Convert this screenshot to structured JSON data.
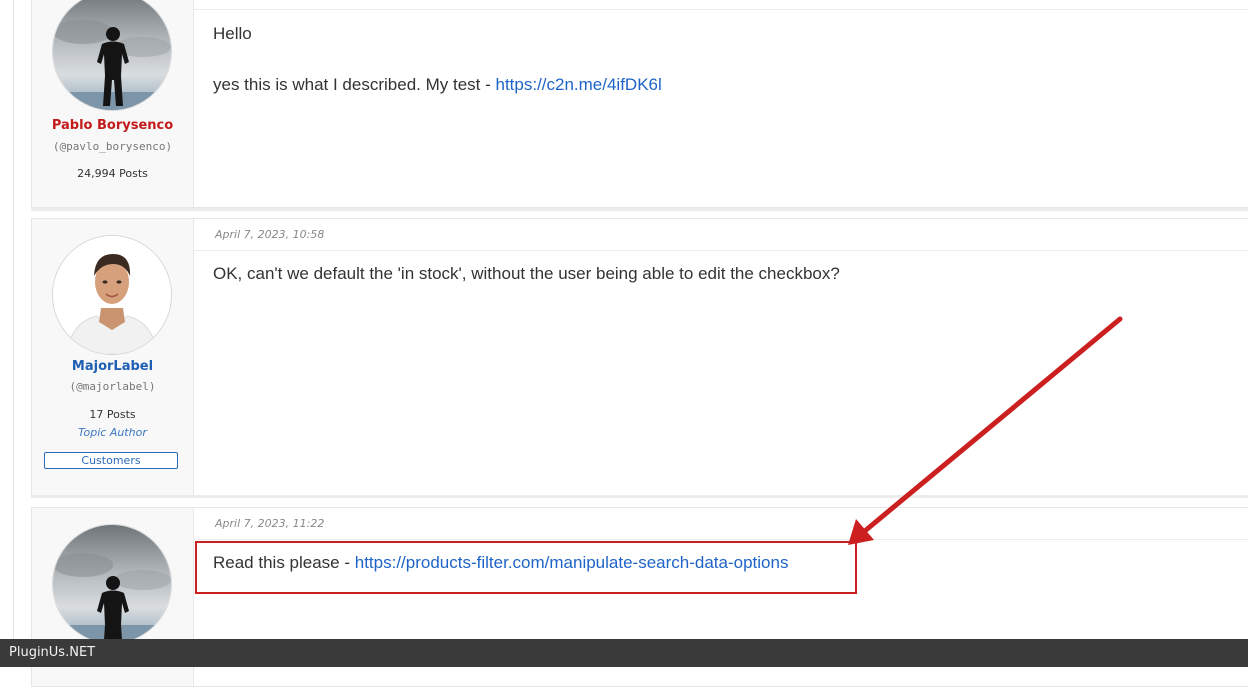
{
  "posts": [
    {
      "author": {
        "name": "Pablo Borysenco",
        "handle": "(@pavlo_borysenco)",
        "posts": "24,994 Posts",
        "name_color": "#c31b1b"
      },
      "lines": [
        "Hello",
        "yes this is what I described. My test - "
      ],
      "link": "https://c2n.me/4ifDK6l"
    },
    {
      "date": "April 7, 2023, 10:58",
      "author": {
        "name": "MajorLabel",
        "handle": "(@majorlabel)",
        "posts": "17 Posts",
        "badge": "Topic Author",
        "role": "Customers",
        "name_color": "#1e5fb4"
      },
      "text": "OK, can't we default the 'in stock', without the user being able to edit the checkbox?"
    },
    {
      "date": "April 7, 2023, 11:22",
      "text_prefix": "Read this please - ",
      "link": "https://products-filter.com/manipulate-search-data-options"
    }
  ],
  "footer": {
    "brand": "PluginUs.NET"
  },
  "annotation": {
    "color": "#cc1f1f"
  }
}
